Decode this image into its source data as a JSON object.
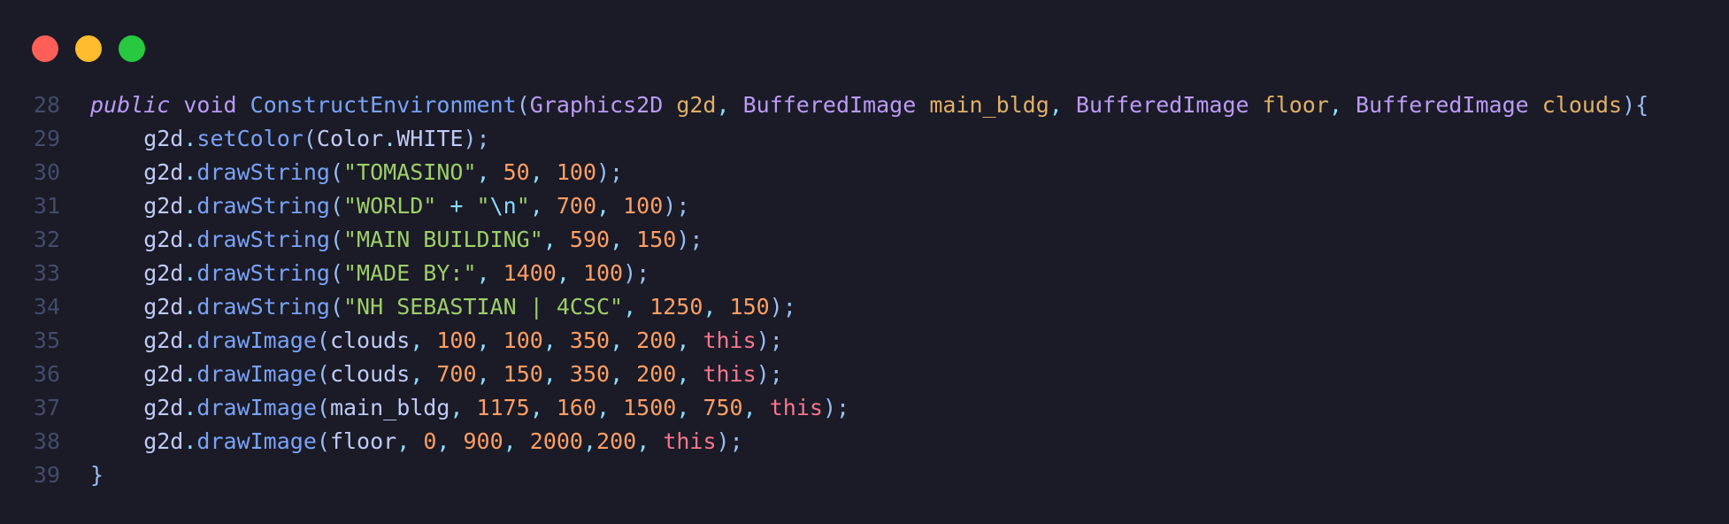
{
  "window": {
    "buttons": [
      "close",
      "minimize",
      "zoom"
    ],
    "colors": {
      "background": "#1a1b26",
      "close": "#ff5f57",
      "minimize": "#febc2e",
      "zoom": "#28c840"
    }
  },
  "code": {
    "lines": [
      {
        "number": "28",
        "tokens": [
          {
            "t": "public",
            "c": "#bb9af7",
            "i": true
          },
          {
            "t": " ",
            "c": "#c0caf5"
          },
          {
            "t": "void",
            "c": "#bb9af7"
          },
          {
            "t": " ",
            "c": "#c0caf5"
          },
          {
            "t": "ConstructEnvironment",
            "c": "#7aa2f7"
          },
          {
            "t": "(",
            "c": "#9abdf5"
          },
          {
            "t": "Graphics2D",
            "c": "#bb9af7"
          },
          {
            "t": " ",
            "c": "#c0caf5"
          },
          {
            "t": "g2d",
            "c": "#e0af68"
          },
          {
            "t": ", ",
            "c": "#89ddff"
          },
          {
            "t": "BufferedImage",
            "c": "#bb9af7"
          },
          {
            "t": " ",
            "c": "#c0caf5"
          },
          {
            "t": "main_bldg",
            "c": "#e0af68"
          },
          {
            "t": ", ",
            "c": "#89ddff"
          },
          {
            "t": "BufferedImage",
            "c": "#bb9af7"
          },
          {
            "t": " ",
            "c": "#c0caf5"
          },
          {
            "t": "floor",
            "c": "#e0af68"
          },
          {
            "t": ", ",
            "c": "#89ddff"
          },
          {
            "t": "BufferedImage",
            "c": "#bb9af7"
          },
          {
            "t": " ",
            "c": "#c0caf5"
          },
          {
            "t": "clouds",
            "c": "#e0af68"
          },
          {
            "t": "){",
            "c": "#9abdf5"
          }
        ]
      },
      {
        "number": "29",
        "tokens": [
          {
            "t": "    g2d",
            "c": "#c0caf5"
          },
          {
            "t": ".",
            "c": "#89ddff"
          },
          {
            "t": "setColor",
            "c": "#7aa2f7"
          },
          {
            "t": "(",
            "c": "#9abdf5"
          },
          {
            "t": "Color",
            "c": "#c0caf5"
          },
          {
            "t": ".",
            "c": "#89ddff"
          },
          {
            "t": "WHITE",
            "c": "#c0caf5"
          },
          {
            "t": ");",
            "c": "#9abdf5"
          }
        ]
      },
      {
        "number": "30",
        "tokens": [
          {
            "t": "    g2d",
            "c": "#c0caf5"
          },
          {
            "t": ".",
            "c": "#89ddff"
          },
          {
            "t": "drawString",
            "c": "#7aa2f7"
          },
          {
            "t": "(",
            "c": "#9abdf5"
          },
          {
            "t": "\"TOMASINO\"",
            "c": "#9ece6a"
          },
          {
            "t": ", ",
            "c": "#89ddff"
          },
          {
            "t": "50",
            "c": "#ff9e64"
          },
          {
            "t": ", ",
            "c": "#89ddff"
          },
          {
            "t": "100",
            "c": "#ff9e64"
          },
          {
            "t": ");",
            "c": "#9abdf5"
          }
        ]
      },
      {
        "number": "31",
        "tokens": [
          {
            "t": "    g2d",
            "c": "#c0caf5"
          },
          {
            "t": ".",
            "c": "#89ddff"
          },
          {
            "t": "drawString",
            "c": "#7aa2f7"
          },
          {
            "t": "(",
            "c": "#9abdf5"
          },
          {
            "t": "\"WORLD\"",
            "c": "#9ece6a"
          },
          {
            "t": " + ",
            "c": "#89ddff"
          },
          {
            "t": "\"",
            "c": "#9ece6a"
          },
          {
            "t": "\\n",
            "c": "#89ddff"
          },
          {
            "t": "\"",
            "c": "#9ece6a"
          },
          {
            "t": ", ",
            "c": "#89ddff"
          },
          {
            "t": "700",
            "c": "#ff9e64"
          },
          {
            "t": ", ",
            "c": "#89ddff"
          },
          {
            "t": "100",
            "c": "#ff9e64"
          },
          {
            "t": ");",
            "c": "#9abdf5"
          }
        ]
      },
      {
        "number": "32",
        "tokens": [
          {
            "t": "    g2d",
            "c": "#c0caf5"
          },
          {
            "t": ".",
            "c": "#89ddff"
          },
          {
            "t": "drawString",
            "c": "#7aa2f7"
          },
          {
            "t": "(",
            "c": "#9abdf5"
          },
          {
            "t": "\"MAIN BUILDING\"",
            "c": "#9ece6a"
          },
          {
            "t": ", ",
            "c": "#89ddff"
          },
          {
            "t": "590",
            "c": "#ff9e64"
          },
          {
            "t": ", ",
            "c": "#89ddff"
          },
          {
            "t": "150",
            "c": "#ff9e64"
          },
          {
            "t": ");",
            "c": "#9abdf5"
          }
        ]
      },
      {
        "number": "33",
        "tokens": [
          {
            "t": "    g2d",
            "c": "#c0caf5"
          },
          {
            "t": ".",
            "c": "#89ddff"
          },
          {
            "t": "drawString",
            "c": "#7aa2f7"
          },
          {
            "t": "(",
            "c": "#9abdf5"
          },
          {
            "t": "\"MADE BY:\"",
            "c": "#9ece6a"
          },
          {
            "t": ", ",
            "c": "#89ddff"
          },
          {
            "t": "1400",
            "c": "#ff9e64"
          },
          {
            "t": ", ",
            "c": "#89ddff"
          },
          {
            "t": "100",
            "c": "#ff9e64"
          },
          {
            "t": ");",
            "c": "#9abdf5"
          }
        ]
      },
      {
        "number": "34",
        "tokens": [
          {
            "t": "    g2d",
            "c": "#c0caf5"
          },
          {
            "t": ".",
            "c": "#89ddff"
          },
          {
            "t": "drawString",
            "c": "#7aa2f7"
          },
          {
            "t": "(",
            "c": "#9abdf5"
          },
          {
            "t": "\"NH SEBASTIAN | 4CSC\"",
            "c": "#9ece6a"
          },
          {
            "t": ", ",
            "c": "#89ddff"
          },
          {
            "t": "1250",
            "c": "#ff9e64"
          },
          {
            "t": ", ",
            "c": "#89ddff"
          },
          {
            "t": "150",
            "c": "#ff9e64"
          },
          {
            "t": ");",
            "c": "#9abdf5"
          }
        ]
      },
      {
        "number": "35",
        "tokens": [
          {
            "t": "    g2d",
            "c": "#c0caf5"
          },
          {
            "t": ".",
            "c": "#89ddff"
          },
          {
            "t": "drawImage",
            "c": "#7aa2f7"
          },
          {
            "t": "(",
            "c": "#9abdf5"
          },
          {
            "t": "clouds",
            "c": "#c0caf5"
          },
          {
            "t": ", ",
            "c": "#89ddff"
          },
          {
            "t": "100",
            "c": "#ff9e64"
          },
          {
            "t": ", ",
            "c": "#89ddff"
          },
          {
            "t": "100",
            "c": "#ff9e64"
          },
          {
            "t": ", ",
            "c": "#89ddff"
          },
          {
            "t": "350",
            "c": "#ff9e64"
          },
          {
            "t": ", ",
            "c": "#89ddff"
          },
          {
            "t": "200",
            "c": "#ff9e64"
          },
          {
            "t": ", ",
            "c": "#89ddff"
          },
          {
            "t": "this",
            "c": "#f7768e"
          },
          {
            "t": ");",
            "c": "#9abdf5"
          }
        ]
      },
      {
        "number": "36",
        "tokens": [
          {
            "t": "    g2d",
            "c": "#c0caf5"
          },
          {
            "t": ".",
            "c": "#89ddff"
          },
          {
            "t": "drawImage",
            "c": "#7aa2f7"
          },
          {
            "t": "(",
            "c": "#9abdf5"
          },
          {
            "t": "clouds",
            "c": "#c0caf5"
          },
          {
            "t": ", ",
            "c": "#89ddff"
          },
          {
            "t": "700",
            "c": "#ff9e64"
          },
          {
            "t": ", ",
            "c": "#89ddff"
          },
          {
            "t": "150",
            "c": "#ff9e64"
          },
          {
            "t": ", ",
            "c": "#89ddff"
          },
          {
            "t": "350",
            "c": "#ff9e64"
          },
          {
            "t": ", ",
            "c": "#89ddff"
          },
          {
            "t": "200",
            "c": "#ff9e64"
          },
          {
            "t": ", ",
            "c": "#89ddff"
          },
          {
            "t": "this",
            "c": "#f7768e"
          },
          {
            "t": ");",
            "c": "#9abdf5"
          }
        ]
      },
      {
        "number": "37",
        "tokens": [
          {
            "t": "    g2d",
            "c": "#c0caf5"
          },
          {
            "t": ".",
            "c": "#89ddff"
          },
          {
            "t": "drawImage",
            "c": "#7aa2f7"
          },
          {
            "t": "(",
            "c": "#9abdf5"
          },
          {
            "t": "main_bldg",
            "c": "#c0caf5"
          },
          {
            "t": ", ",
            "c": "#89ddff"
          },
          {
            "t": "1175",
            "c": "#ff9e64"
          },
          {
            "t": ", ",
            "c": "#89ddff"
          },
          {
            "t": "160",
            "c": "#ff9e64"
          },
          {
            "t": ", ",
            "c": "#89ddff"
          },
          {
            "t": "1500",
            "c": "#ff9e64"
          },
          {
            "t": ", ",
            "c": "#89ddff"
          },
          {
            "t": "750",
            "c": "#ff9e64"
          },
          {
            "t": ", ",
            "c": "#89ddff"
          },
          {
            "t": "this",
            "c": "#f7768e"
          },
          {
            "t": ");",
            "c": "#9abdf5"
          }
        ]
      },
      {
        "number": "38",
        "tokens": [
          {
            "t": "    g2d",
            "c": "#c0caf5"
          },
          {
            "t": ".",
            "c": "#89ddff"
          },
          {
            "t": "drawImage",
            "c": "#7aa2f7"
          },
          {
            "t": "(",
            "c": "#9abdf5"
          },
          {
            "t": "floor",
            "c": "#c0caf5"
          },
          {
            "t": ", ",
            "c": "#89ddff"
          },
          {
            "t": "0",
            "c": "#ff9e64"
          },
          {
            "t": ", ",
            "c": "#89ddff"
          },
          {
            "t": "900",
            "c": "#ff9e64"
          },
          {
            "t": ", ",
            "c": "#89ddff"
          },
          {
            "t": "2000",
            "c": "#ff9e64"
          },
          {
            "t": ",",
            "c": "#89ddff"
          },
          {
            "t": "200",
            "c": "#ff9e64"
          },
          {
            "t": ", ",
            "c": "#89ddff"
          },
          {
            "t": "this",
            "c": "#f7768e"
          },
          {
            "t": ");",
            "c": "#9abdf5"
          }
        ]
      },
      {
        "number": "39",
        "tokens": [
          {
            "t": "}",
            "c": "#9abdf5"
          }
        ]
      }
    ]
  }
}
